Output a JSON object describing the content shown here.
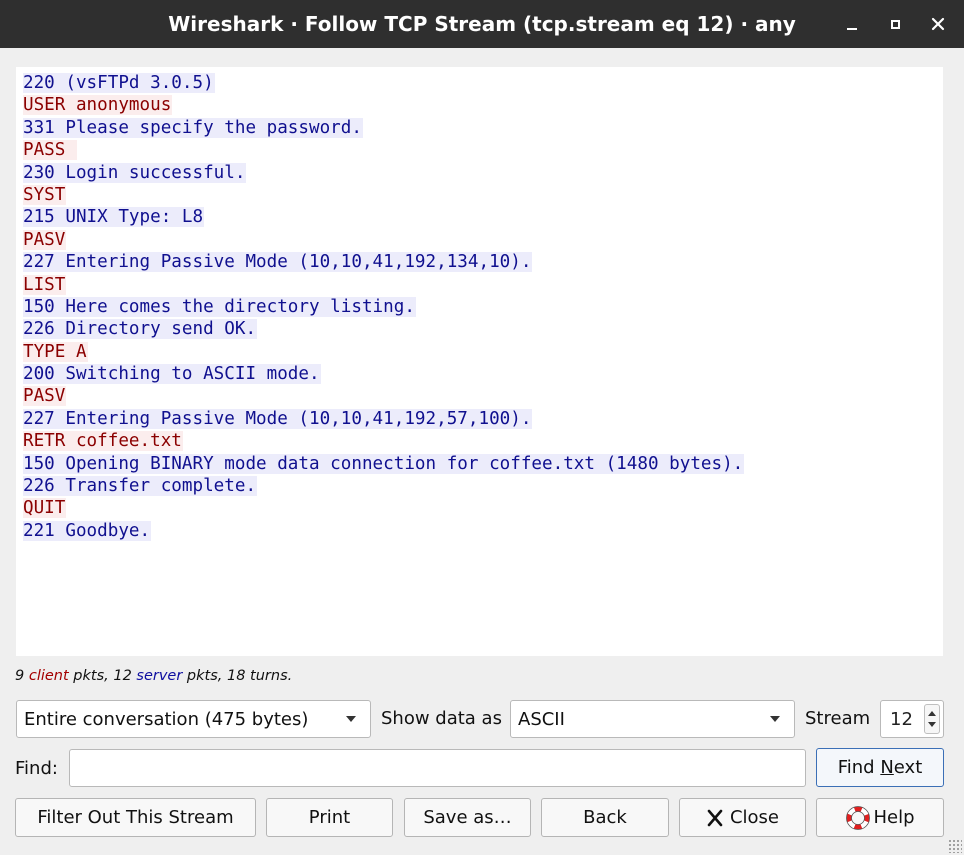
{
  "window": {
    "title": "Wireshark · Follow TCP Stream (tcp.stream eq 12) · any"
  },
  "stream_lines": [
    {
      "text": "220 (vsFTPd 3.0.5)",
      "side": "server"
    },
    {
      "text": "USER anonymous",
      "side": "client"
    },
    {
      "text": "331 Please specify the password.",
      "side": "server"
    },
    {
      "text": "PASS ",
      "side": "client"
    },
    {
      "text": "230 Login successful.",
      "side": "server"
    },
    {
      "text": "SYST",
      "side": "client"
    },
    {
      "text": "215 UNIX Type: L8",
      "side": "server"
    },
    {
      "text": "PASV",
      "side": "client"
    },
    {
      "text": "227 Entering Passive Mode (10,10,41,192,134,10).",
      "side": "server"
    },
    {
      "text": "LIST",
      "side": "client"
    },
    {
      "text": "150 Here comes the directory listing.",
      "side": "server"
    },
    {
      "text": "226 Directory send OK.",
      "side": "server"
    },
    {
      "text": "TYPE A",
      "side": "client"
    },
    {
      "text": "200 Switching to ASCII mode.",
      "side": "server"
    },
    {
      "text": "PASV",
      "side": "client"
    },
    {
      "text": "227 Entering Passive Mode (10,10,41,192,57,100).",
      "side": "server"
    },
    {
      "text": "RETR coffee.txt",
      "side": "client"
    },
    {
      "text": "150 Opening BINARY mode data connection for coffee.txt (1480 bytes).",
      "side": "server"
    },
    {
      "text": "226 Transfer complete.",
      "side": "server"
    },
    {
      "text": "QUIT",
      "side": "client"
    },
    {
      "text": "221 Goodbye.",
      "side": "server"
    }
  ],
  "stats": {
    "client_count": "9",
    "client_word": "client",
    "middle": "pkts, 12",
    "server_word": "server",
    "tail": "pkts, 18 turns."
  },
  "conversation_select": {
    "value": "Entire conversation (475 bytes)"
  },
  "show_data_as": {
    "label": "Show data as",
    "value": "ASCII"
  },
  "stream": {
    "label": "Stream",
    "value": "12"
  },
  "find": {
    "label": "Find:",
    "value": "",
    "button_prefix": "Find ",
    "button_underlined": "N",
    "button_suffix": "ext"
  },
  "buttons": {
    "filter_out": "Filter Out This Stream",
    "print": "Print",
    "save_as": "Save as…",
    "back": "Back",
    "close": "Close",
    "help": "Help"
  },
  "colors": {
    "client_fg": "#8b0000",
    "client_bg": "#fbeded",
    "server_fg": "#10108f",
    "server_bg": "#ececfb",
    "titlebar": "#2f2f2f"
  },
  "icons": {
    "close": "x-icon",
    "help": "lifebuoy-icon"
  }
}
